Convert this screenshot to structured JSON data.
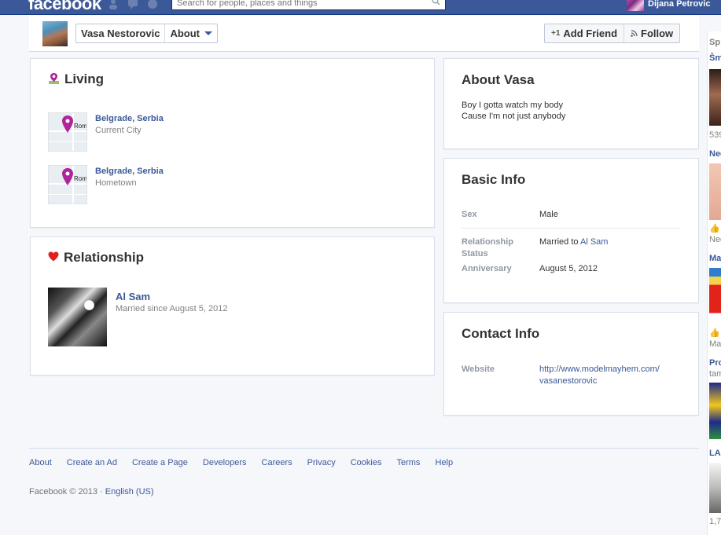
{
  "topbar": {
    "logo": "facebook",
    "search_placeholder": "Search for people, places and things",
    "user_name": "Dijana Petrovic"
  },
  "profile_header": {
    "name": "Vasa Nestorovic",
    "section": "About",
    "add_friend": "Add Friend",
    "follow": "Follow"
  },
  "living": {
    "title": "Living",
    "places": [
      {
        "name": "Belgrade, Serbia",
        "type": "Current City"
      },
      {
        "name": "Belgrade, Serbia",
        "type": "Hometown"
      }
    ]
  },
  "relationship": {
    "title": "Relationship",
    "partner": "Al Sam",
    "since": "Married since August 5, 2012"
  },
  "about": {
    "title": "About Vasa",
    "line1": "Boy I gotta watch my body",
    "line2": "Cause I'm not just anybody"
  },
  "basic_info": {
    "title": "Basic Info",
    "sex_label": "Sex",
    "sex_value": "Male",
    "rel_label": "Relationship Status",
    "rel_value_prefix": "Married to",
    "rel_value_link": "Al Sam",
    "anniv_label": "Anniversary",
    "anniv_value": "August 5, 2012"
  },
  "contact_info": {
    "title": "Contact Info",
    "website_label": "Website",
    "website_line1": "http://www.modelmayhem.com/",
    "website_line2": "vasanestorovic"
  },
  "footer": {
    "links": [
      "About",
      "Create an Ad",
      "Create a Page",
      "Developers",
      "Careers",
      "Privacy",
      "Cookies",
      "Terms",
      "Help"
    ],
    "copyright": "Facebook © 2013 ·",
    "language": "English (US)"
  },
  "right_column": {
    "items": [
      "Sp",
      "Šm",
      "539",
      "Neg",
      "Neg",
      "Ma",
      "Max",
      "Pro",
      "tam",
      "LAS",
      "1,7"
    ]
  },
  "colors": {
    "brand_blue": "#3b5998",
    "link_blue": "#3b5998",
    "heart_red": "#e02020",
    "pin_purple": "#b0249b"
  }
}
